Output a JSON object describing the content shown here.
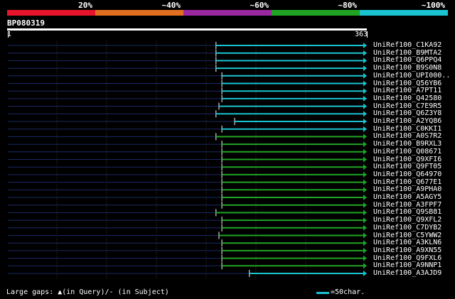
{
  "query": {
    "id": "BP080319",
    "start": "1",
    "end": "363",
    "length": 363
  },
  "legend": [
    {
      "label": "20%",
      "color": "#e8142b"
    },
    {
      "label": "~40%",
      "color": "#e07020"
    },
    {
      "label": "~60%",
      "color": "#9a28a0"
    },
    {
      "label": "~80%",
      "color": "#21a424"
    },
    {
      "label": "~100%",
      "color": "#19c3d0"
    }
  ],
  "footer": {
    "gaps_text": "Large gaps: ▲(in Query)/- (in Subject)",
    "scale_text": "=50char."
  },
  "hits": [
    {
      "name": "UniRef100_C1KA92",
      "start": 213,
      "end": 363,
      "identity": "~100%"
    },
    {
      "name": "UniRef100_B9MTA2",
      "start": 213,
      "end": 363,
      "identity": "~100%"
    },
    {
      "name": "UniRef100_Q6PPQ4",
      "start": 213,
      "end": 363,
      "identity": "~100%"
    },
    {
      "name": "UniRef100_B9S0N8",
      "start": 213,
      "end": 363,
      "identity": "~100%"
    },
    {
      "name": "UniRef100_UPI000..",
      "start": 219,
      "end": 363,
      "identity": "~100%"
    },
    {
      "name": "UniRef100_Q56YB6",
      "start": 219,
      "end": 363,
      "identity": "~100%"
    },
    {
      "name": "UniRef100_A7PT11",
      "start": 219,
      "end": 363,
      "identity": "~100%"
    },
    {
      "name": "UniRef100_Q42580",
      "start": 219,
      "end": 363,
      "identity": "~100%"
    },
    {
      "name": "UniRef100_C7E9R5",
      "start": 216,
      "end": 363,
      "identity": "~100%"
    },
    {
      "name": "UniRef100_Q6Z3Y8",
      "start": 213,
      "end": 363,
      "identity": "~100%"
    },
    {
      "name": "UniRef100_A2YQ86",
      "start": 232,
      "end": 363,
      "identity": "~100%"
    },
    {
      "name": "UniRef100_C0KKI1",
      "start": 219,
      "end": 363,
      "identity": "~100%"
    },
    {
      "name": "UniRef100_A0S7R2",
      "start": 213,
      "end": 363,
      "identity": "~80%"
    },
    {
      "name": "UniRef100_B9RXL3",
      "start": 219,
      "end": 363,
      "identity": "~80%"
    },
    {
      "name": "UniRef100_Q08671",
      "start": 219,
      "end": 363,
      "identity": "~80%"
    },
    {
      "name": "UniRef100_Q9XFI6",
      "start": 219,
      "end": 363,
      "identity": "~80%"
    },
    {
      "name": "UniRef100_Q9FT05",
      "start": 219,
      "end": 363,
      "identity": "~80%"
    },
    {
      "name": "UniRef100_Q64970",
      "start": 219,
      "end": 363,
      "identity": "~80%"
    },
    {
      "name": "UniRef100_Q677E1",
      "start": 219,
      "end": 363,
      "identity": "~80%"
    },
    {
      "name": "UniRef100_A9PHA0",
      "start": 219,
      "end": 363,
      "identity": "~80%"
    },
    {
      "name": "UniRef100_A5AGY5",
      "start": 219,
      "end": 363,
      "identity": "~80%"
    },
    {
      "name": "UniRef100_A3FPF7",
      "start": 219,
      "end": 363,
      "identity": "~80%"
    },
    {
      "name": "UniRef100_Q9SB81",
      "start": 213,
      "end": 363,
      "identity": "~80%"
    },
    {
      "name": "UniRef100_Q9XFL2",
      "start": 219,
      "end": 363,
      "identity": "~80%"
    },
    {
      "name": "UniRef100_C7DYB2",
      "start": 219,
      "end": 363,
      "identity": "~80%"
    },
    {
      "name": "UniRef100_C5YWW2",
      "start": 216,
      "end": 363,
      "identity": "~80%"
    },
    {
      "name": "UniRef100_A3KLN6",
      "start": 219,
      "end": 363,
      "identity": "~80%"
    },
    {
      "name": "UniRef100_A9XN55",
      "start": 219,
      "end": 363,
      "identity": "~80%"
    },
    {
      "name": "UniRef100_Q9FXL6",
      "start": 219,
      "end": 363,
      "identity": "~80%"
    },
    {
      "name": "UniRef100_A9NNP1",
      "start": 219,
      "end": 363,
      "identity": "~80%"
    },
    {
      "name": "UniRef100_A3AJD9",
      "start": 247,
      "end": 363,
      "identity": "~100%"
    }
  ]
}
